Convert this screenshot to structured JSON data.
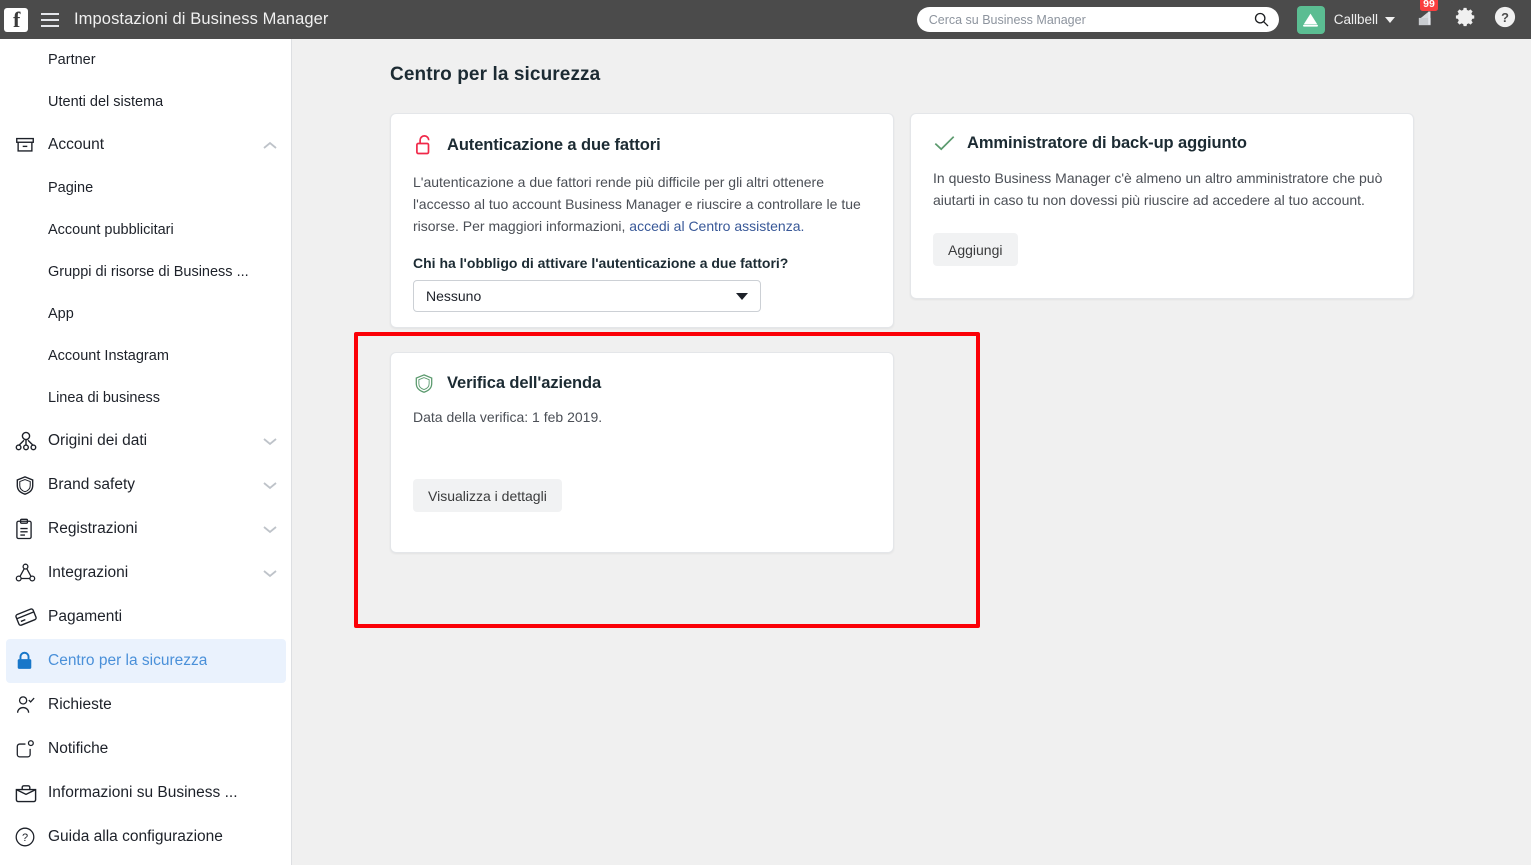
{
  "topbar": {
    "logo_icon": "facebook-logo-icon",
    "menu_icon": "hamburger-menu-icon",
    "title": "Impostazioni di Business Manager",
    "search": {
      "placeholder": "Cerca su Business Manager",
      "value": "",
      "icon": "search-icon"
    },
    "account": {
      "name": "Callbell",
      "avatar_icon": "callbell-bell-logo-icon",
      "avatar_color": "#5bbd92",
      "caret_icon": "chevron-down-icon"
    },
    "notifications": {
      "icon": "megaphone-icon",
      "badge": "99",
      "badge_color": "#fa3e3e"
    },
    "settings_icon": "gear-icon",
    "help_icon": "question-circle-icon",
    "background_color": "#4b4b4b"
  },
  "sidebar": {
    "items": [
      {
        "label": "Partner",
        "icon": "",
        "sub": true,
        "expand": "",
        "active": false
      },
      {
        "label": "Utenti del sistema",
        "icon": "",
        "sub": true,
        "expand": "",
        "active": false
      },
      {
        "label": "Account",
        "icon": "archive-box-icon",
        "sub": false,
        "expand": "up",
        "active": false
      },
      {
        "label": "Pagine",
        "icon": "",
        "sub": true,
        "expand": "",
        "active": false
      },
      {
        "label": "Account pubblicitari",
        "icon": "",
        "sub": true,
        "expand": "",
        "active": false
      },
      {
        "label": "Gruppi di risorse di Business ...",
        "icon": "",
        "sub": true,
        "expand": "",
        "active": false
      },
      {
        "label": "App",
        "icon": "",
        "sub": true,
        "expand": "",
        "active": false
      },
      {
        "label": "Account Instagram",
        "icon": "",
        "sub": true,
        "expand": "",
        "active": false
      },
      {
        "label": "Linea di business",
        "icon": "",
        "sub": true,
        "expand": "",
        "active": false
      },
      {
        "label": "Origini dei dati",
        "icon": "data-sources-icon",
        "sub": false,
        "expand": "down",
        "active": false
      },
      {
        "label": "Brand safety",
        "icon": "shield-icon",
        "sub": false,
        "expand": "down",
        "active": false
      },
      {
        "label": "Registrazioni",
        "icon": "clipboard-icon",
        "sub": false,
        "expand": "down",
        "active": false
      },
      {
        "label": "Integrazioni",
        "icon": "integrations-icon",
        "sub": false,
        "expand": "down",
        "active": false
      },
      {
        "label": "Pagamenti",
        "icon": "credit-card-icon",
        "sub": false,
        "expand": "",
        "active": false
      },
      {
        "label": "Centro per la sicurezza",
        "icon": "lock-icon",
        "sub": false,
        "expand": "",
        "active": true
      },
      {
        "label": "Richieste",
        "icon": "user-check-icon",
        "sub": false,
        "expand": "",
        "active": false
      },
      {
        "label": "Notifiche",
        "icon": "notification-icon",
        "sub": false,
        "expand": "",
        "active": false
      },
      {
        "label": "Informazioni su Business ...",
        "icon": "briefcase-icon",
        "sub": false,
        "expand": "",
        "active": false
      },
      {
        "label": "Guida alla configurazione",
        "icon": "question-circle-icon",
        "sub": false,
        "expand": "",
        "active": false
      }
    ],
    "active_bg_color": "#eaf2fd",
    "active_text_color": "#4a90d9"
  },
  "main": {
    "page_title": "Centro per la sicurezza",
    "cards": {
      "two_factor": {
        "icon": "unlocked-padlock-icon",
        "icon_color": "#f02849",
        "title": "Autenticazione a due fattori",
        "body_text": "L'autenticazione a due fattori rende più difficile per gli altri ottenere l'accesso al tuo account Business Manager e riuscire a controllare le tue risorse. Per maggiori informazioni, ",
        "body_link": "accedi al Centro assistenza.",
        "question_label": "Chi ha l'obbligo di attivare l'autenticazione a due fattori?",
        "select_value": "Nessuno",
        "select_caret_icon": "chevron-down-icon"
      },
      "backup_admin": {
        "icon": "green-check-icon",
        "icon_color": "#5b9a6e",
        "title": "Amministratore di back-up aggiunto",
        "body_text": "In questo Business Manager c'è almeno un altro amministratore che può aiutarti in caso tu non dovessi più riuscire ad accedere al tuo account.",
        "button_label": "Aggiungi"
      },
      "business_verification": {
        "icon": "green-shield-icon",
        "icon_color": "#5b9a6e",
        "title": "Verifica dell'azienda",
        "body_text": "Data della verifica: 1 feb 2019.",
        "button_label": "Visualizza i dettagli"
      }
    },
    "highlight": {
      "name": "red-annotation-rectangle",
      "color": "#fb0007"
    },
    "background_color": "#f0f0f0"
  }
}
